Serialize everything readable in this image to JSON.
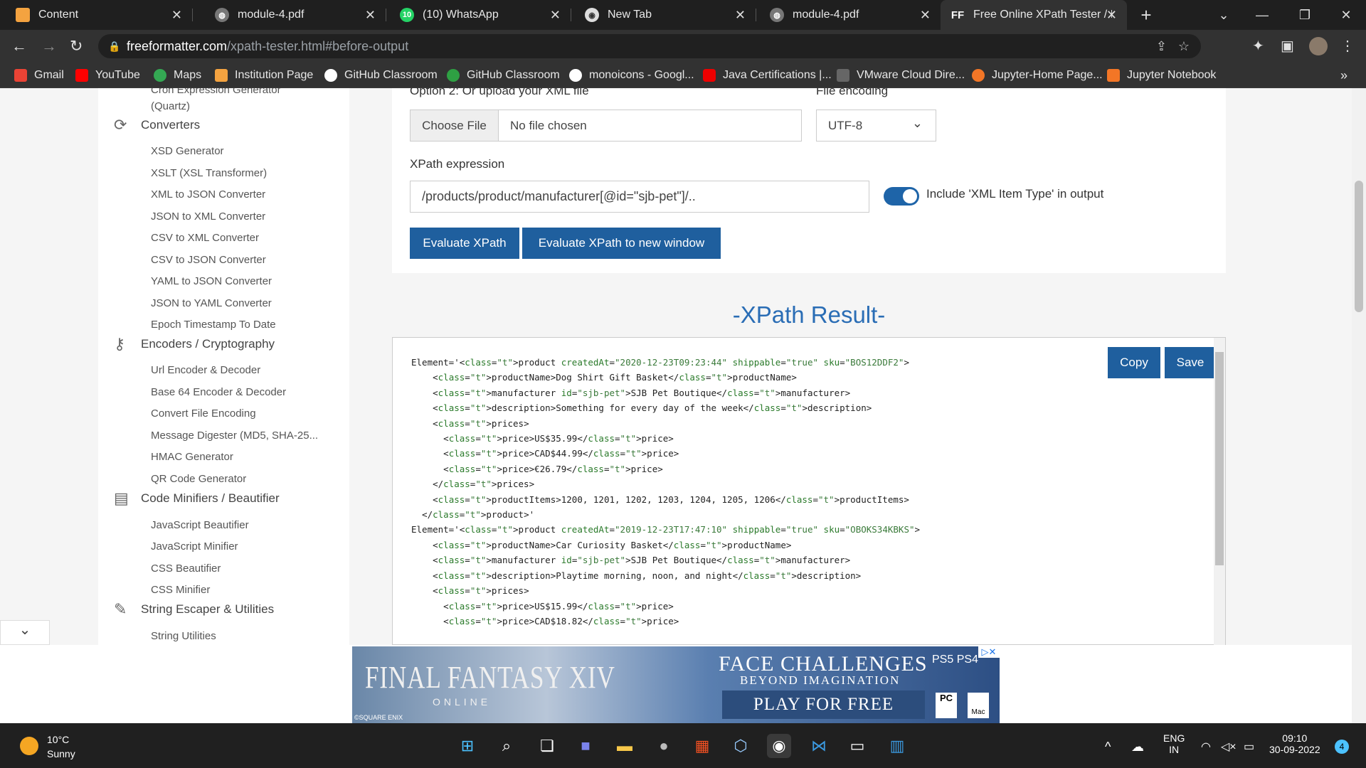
{
  "browser": {
    "tabs": [
      {
        "title": "Content",
        "color": "#f4a340"
      },
      {
        "title": "module-4.pdf",
        "color": "#888888"
      },
      {
        "title": "(10) WhatsApp",
        "color": "#25d366"
      },
      {
        "title": "New Tab",
        "color": "#dddddd"
      },
      {
        "title": "module-4.pdf",
        "color": "#888888"
      },
      {
        "title": "Free Online XPath Tester / E",
        "color": "#323232",
        "active": true,
        "fav_text": "FF"
      }
    ],
    "url_domain": "freeformatter.com",
    "url_path": "/xpath-tester.html#before-output",
    "bookmarks": [
      "Gmail",
      "YouTube",
      "Maps",
      "Institution Page",
      "GitHub Classroom",
      "GitHub Classroom",
      "monoicons - Googl...",
      "Java Certifications |...",
      "VMware Cloud Dire...",
      "Jupyter-Home Page...",
      "Jupyter Notebook"
    ],
    "more_bookmarks": "»"
  },
  "sidebar": {
    "cut_top": "Cron Expression Generator",
    "cut_top2": "(Quartz)",
    "sections": [
      {
        "title": "Converters",
        "items": [
          "XSD Generator",
          "XSLT (XSL Transformer)",
          "XML to JSON Converter",
          "JSON to XML Converter",
          "CSV to XML Converter",
          "CSV to JSON Converter",
          "YAML to JSON Converter",
          "JSON to YAML Converter",
          "Epoch Timestamp To Date"
        ]
      },
      {
        "title": "Encoders / Cryptography",
        "items": [
          "Url Encoder & Decoder",
          "Base 64 Encoder & Decoder",
          "Convert File Encoding",
          "Message Digester (MD5, SHA-25...",
          "HMAC Generator",
          "QR Code Generator"
        ]
      },
      {
        "title": "Code Minifiers / Beautifier",
        "items": [
          "JavaScript Beautifier",
          "JavaScript Minifier",
          "CSS Beautifier",
          "CSS Minifier"
        ]
      },
      {
        "title": "String Escaper & Utilities",
        "items": [
          "String Utilities"
        ]
      }
    ]
  },
  "form": {
    "upload_label": "Option 2: Or upload your XML file",
    "encoding_label": "File encoding",
    "choose_file": "Choose File",
    "no_file": "No file chosen",
    "encoding_value": "UTF-8",
    "xpath_label": "XPath expression",
    "xpath_value": "/products/product/manufacturer[@id=\"sjb-pet\"]/..",
    "toggle_label": "Include 'XML Item Type' in output",
    "toggle_on": true,
    "evaluate": "Evaluate XPath",
    "evaluate_new": "Evaluate XPath to new window"
  },
  "result": {
    "title": "-XPath Result-",
    "copy": "Copy",
    "save": "Save",
    "lines": [
      "Element='<product createdAt=\"2020-12-23T09:23:44\" shippable=\"true\" sku=\"BOS12DDF2\">",
      "    <productName>Dog Shirt Gift Basket</productName>",
      "    <manufacturer id=\"sjb-pet\">SJB Pet Boutique</manufacturer>",
      "    <description>Something for every day of the week</description>",
      "    <prices>",
      "      <price>US$35.99</price>",
      "      <price>CAD$44.99</price>",
      "      <price>€26.79</price>",
      "    </prices>",
      "    <productItems>1200, 1201, 1202, 1203, 1204, 1205, 1206</productItems>",
      "  </product>'",
      "Element='<product createdAt=\"2019-12-23T17:47:10\" shippable=\"true\" sku=\"OBOKS34KBKS\">",
      "    <productName>Car Curiosity Basket</productName>",
      "    <manufacturer id=\"sjb-pet\">SJB Pet Boutique</manufacturer>",
      "    <description>Playtime morning, noon, and night</description>",
      "    <prices>",
      "      <price>US$15.99</price>",
      "      <price>CAD$18.82</price>"
    ]
  },
  "ad": {
    "title": "FINAL FANTASY XIV",
    "online": "ONLINE",
    "publisher": "©SQUARE ENIX",
    "headline": "FACE CHALLENGES",
    "subline": "BEYOND IMAGINATION",
    "cta": "PLAY FOR FREE",
    "platforms": "PS5 PS4",
    "pc": "PC",
    "mac": "Mac"
  },
  "taskbar": {
    "temp": "10°C",
    "condition": "Sunny",
    "lang1": "ENG",
    "lang2": "IN",
    "time": "09:10",
    "date": "30-09-2022",
    "notifications": "4"
  }
}
